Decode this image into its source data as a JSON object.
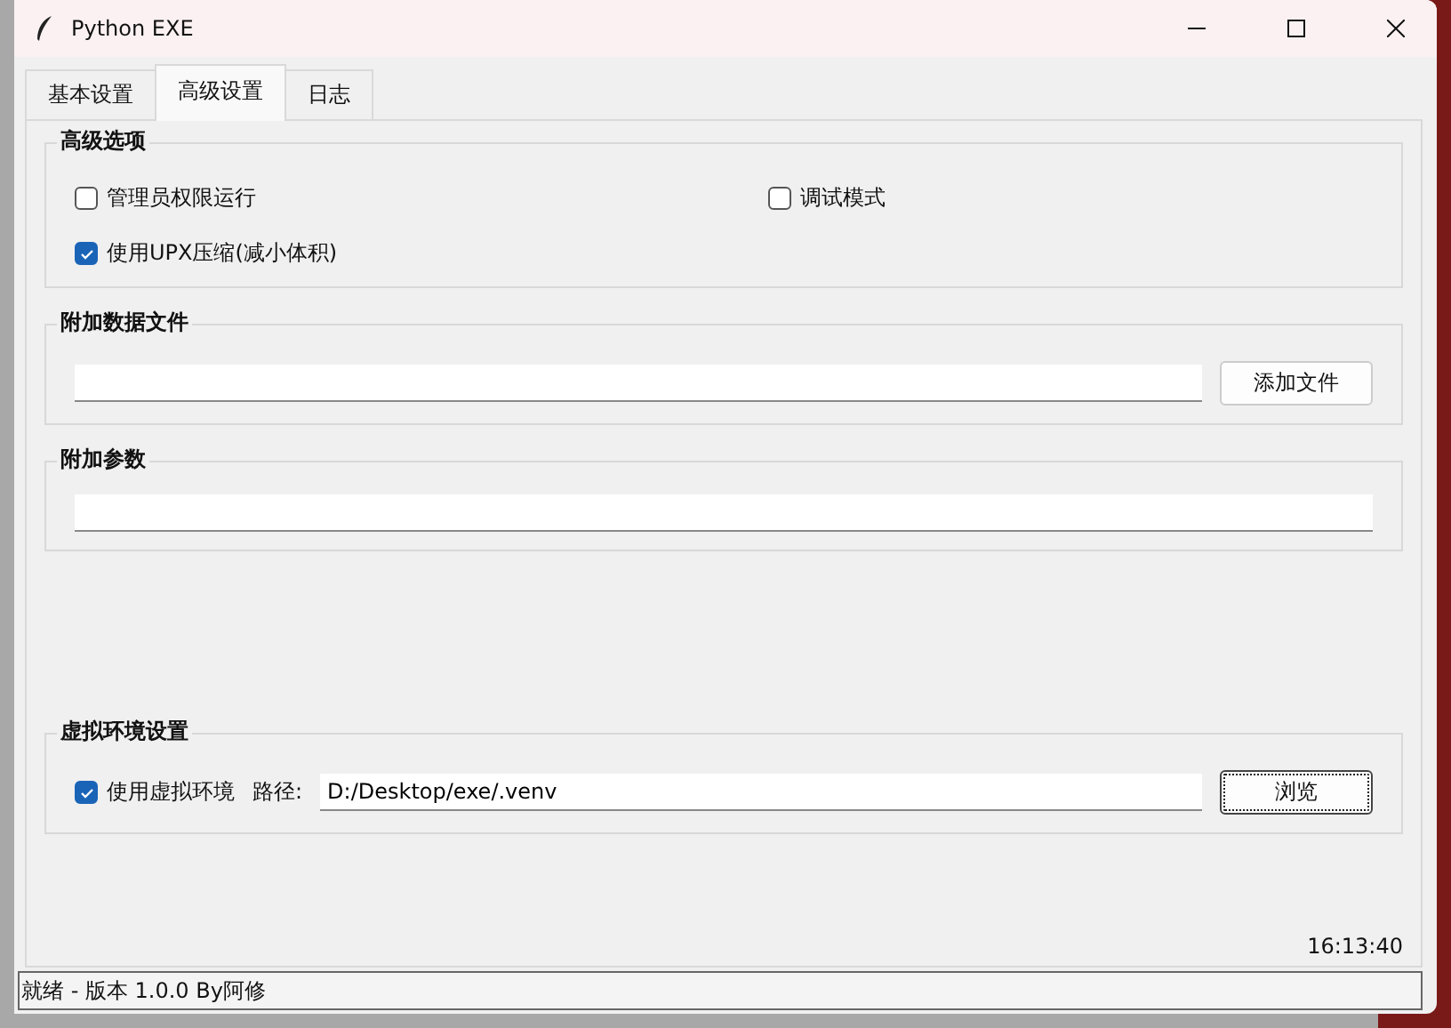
{
  "window": {
    "title": "Python EXE"
  },
  "tabs": [
    {
      "label": "基本设置",
      "selected": false
    },
    {
      "label": "高级设置",
      "selected": true
    },
    {
      "label": "日志",
      "selected": false
    }
  ],
  "sections": [
    {
      "kind": "options",
      "title": "高级选项",
      "options": [
        {
          "label": "管理员权限运行",
          "checked": false
        },
        {
          "label": "调试模式",
          "checked": false
        },
        {
          "label": "使用UPX压缩(减小体积)",
          "checked": true
        }
      ]
    },
    {
      "kind": "file",
      "title": "附加数据文件",
      "button": "添加文件"
    },
    {
      "kind": "field",
      "title": "附加参数"
    },
    {
      "kind": "venv",
      "title": "虚拟环境设置",
      "option": {
        "label": "使用虚拟环境",
        "checked": true
      },
      "path_label": "路径:",
      "path": "D:/Desktop/exe/.venv",
      "button": "浏览"
    }
  ],
  "time": "16:13:40",
  "status_bar": "就绪 - 版本 1.0.0 By阿修"
}
